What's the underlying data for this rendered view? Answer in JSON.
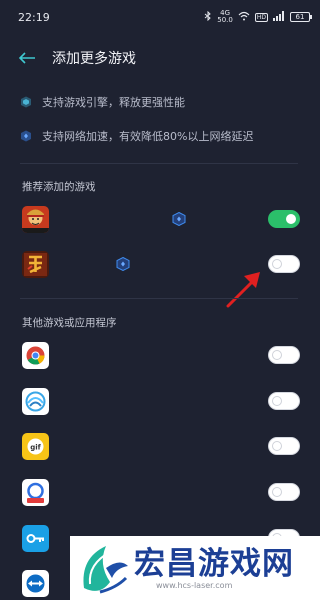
{
  "status": {
    "time": "22:19",
    "signal_label_top": "4G",
    "signal_label_bottom": "50.0",
    "hd_badge": "HD",
    "battery": "61"
  },
  "header": {
    "title": "添加更多游戏"
  },
  "info": [
    {
      "icon": "engine-icon",
      "text": "支持游戏引擎，释放更强性能"
    },
    {
      "icon": "network-accel-icon",
      "text": "支持网络加速，有效降低80%以上网络延迟"
    }
  ],
  "recommended": {
    "label": "推荐添加的游戏",
    "apps": [
      {
        "icon": "one-piece-game-icon",
        "accelerated": true,
        "enabled": true
      },
      {
        "icon": "three-kingdoms-game-icon",
        "accelerated": true,
        "enabled": false
      }
    ]
  },
  "others": {
    "label": "其他游戏或应用程序",
    "apps": [
      {
        "icon": "chrome-icon",
        "enabled": false
      },
      {
        "icon": "cloud-app-icon",
        "enabled": false
      },
      {
        "icon": "gif-app-icon",
        "enabled": false
      },
      {
        "icon": "cloud-upload-app-icon",
        "enabled": false
      },
      {
        "icon": "key-app-icon",
        "enabled": false
      },
      {
        "icon": "teamviewer-icon",
        "enabled": false
      }
    ]
  },
  "watermark": {
    "brand": "宏昌游戏网",
    "url": "www.hcs-laser.com"
  },
  "colors": {
    "background": "#1e2231",
    "accent": "#3f8cf0",
    "toggle_on": "#2bbf6a",
    "arrow": "#e02020"
  }
}
